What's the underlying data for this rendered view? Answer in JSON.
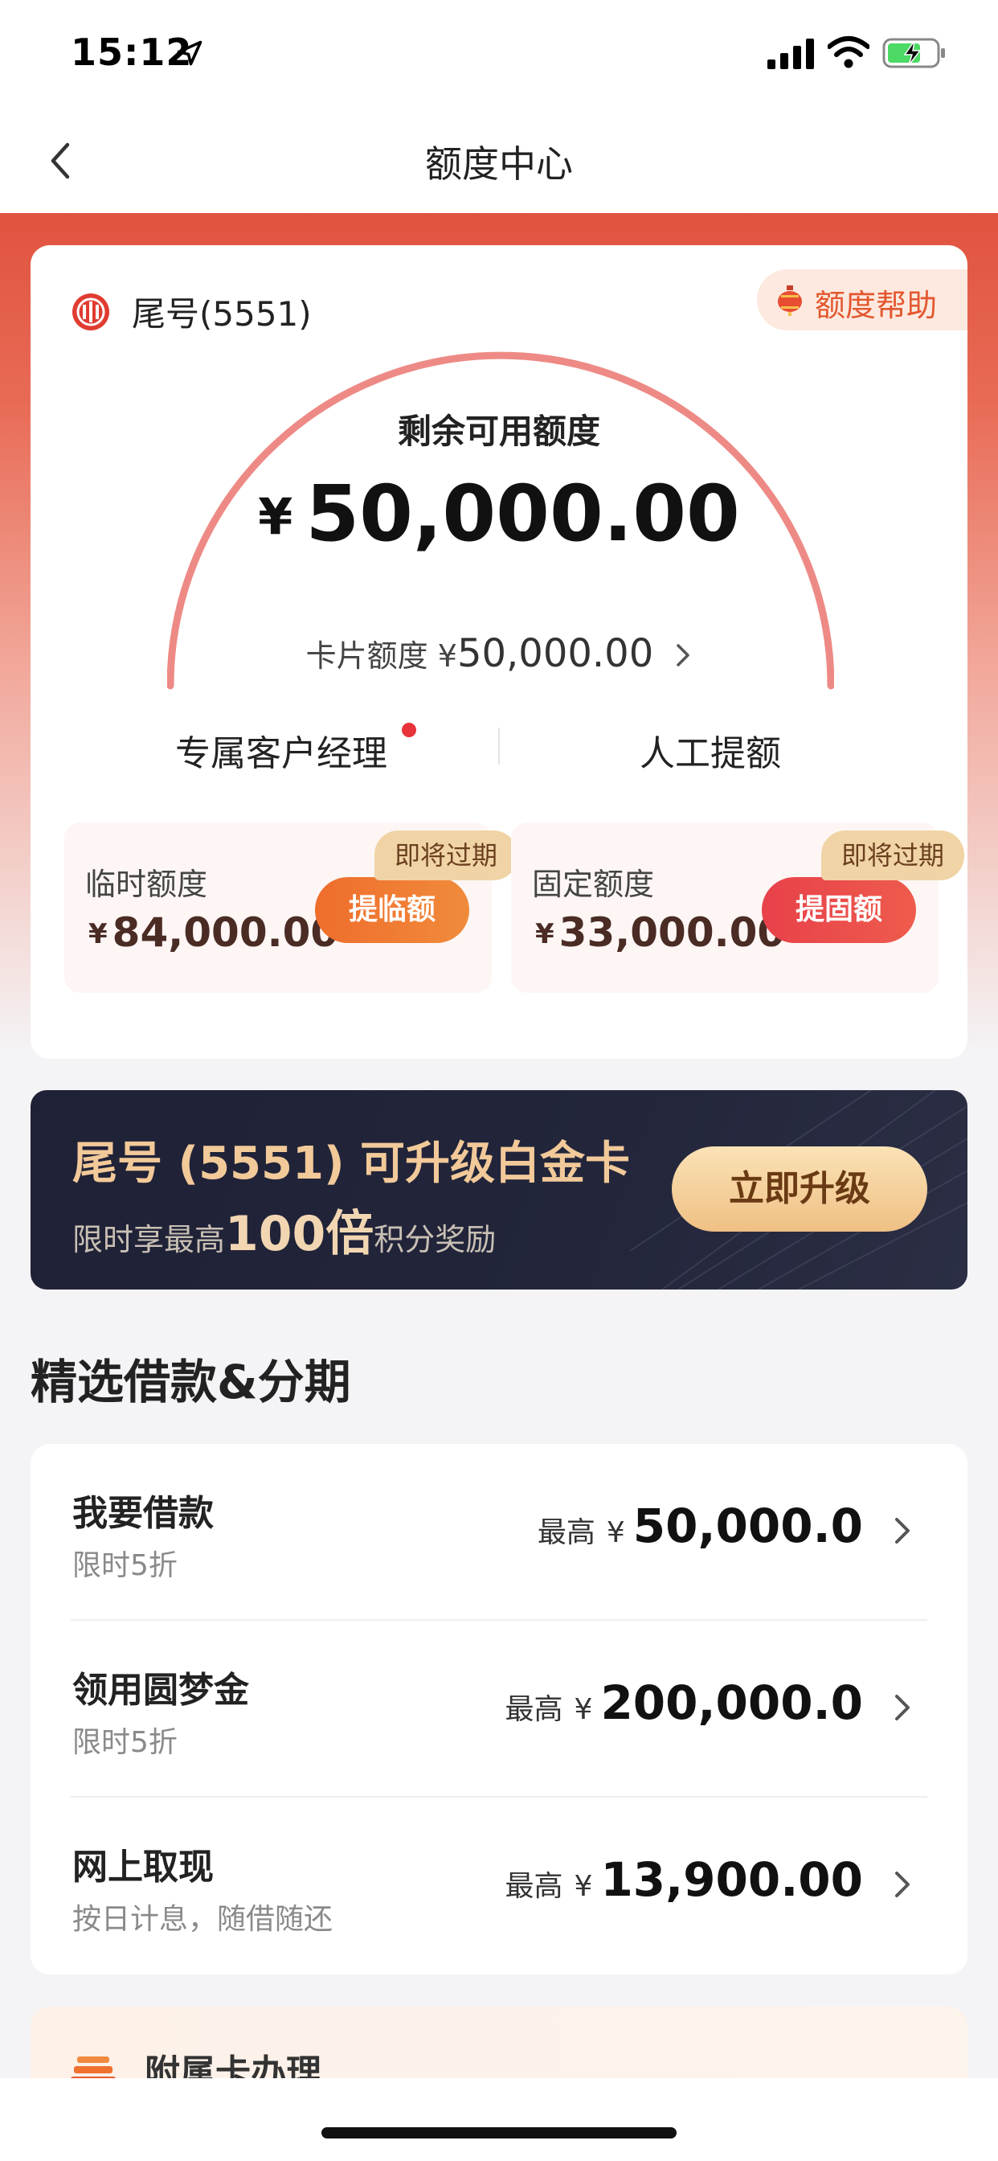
{
  "status_bar": {
    "time": "15:12"
  },
  "nav": {
    "title": "额度中心"
  },
  "quota_card": {
    "card_tail": "尾号(5551)",
    "help_label": "额度帮助",
    "remaining_label": "剩余可用额度",
    "remaining_currency": "¥",
    "remaining_value": "50,000.00",
    "card_limit_label": "卡片额度 ¥",
    "card_limit_value": "50,000.00",
    "actions": {
      "manager": "专属客户经理",
      "manual": "人工提额"
    },
    "temporary": {
      "title": "临时额度",
      "currency": "¥",
      "value": "84,000.00",
      "tag": "即将过期",
      "button": "提临额"
    },
    "fixed": {
      "title": "固定额度",
      "currency": "¥",
      "value": "33,000.00",
      "tag": "即将过期",
      "button": "提固额"
    }
  },
  "upgrade_banner": {
    "title": "尾号 (5551) 可升级白金卡",
    "sub_prefix": "限时享最高",
    "sub_highlight": "100倍",
    "sub_suffix": "积分奖励",
    "button": "立即升级"
  },
  "section": {
    "title": "精选借款&分期"
  },
  "loans": [
    {
      "name": "我要借款",
      "desc": "限时5折",
      "prefix": "最高",
      "currency": "¥",
      "value": "50,000.0"
    },
    {
      "name": "领用圆梦金",
      "desc": "限时5折",
      "prefix": "最高",
      "currency": "¥",
      "value": "200,000.0"
    },
    {
      "name": "网上取现",
      "desc": "按日计息，随借随还",
      "prefix": "最高",
      "currency": "¥",
      "value": "13,900.00"
    }
  ],
  "supplementary": {
    "title": "附属卡办理"
  },
  "colors": {
    "brand_red": "#e0533f",
    "accent_orange": "#ef6d2c",
    "accent_red": "#e8414a",
    "gold": "#f2c999",
    "banner_dark": "#1f2136"
  },
  "icons": {
    "location": "location-arrow-icon",
    "signal": "cellular-signal-icon",
    "wifi": "wifi-icon",
    "battery": "battery-charging-icon",
    "back": "chevron-left-icon",
    "bank": "bank-logo-icon",
    "help": "lantern-icon",
    "chevron": "chevron-right-icon",
    "supp": "card-stack-icon"
  }
}
